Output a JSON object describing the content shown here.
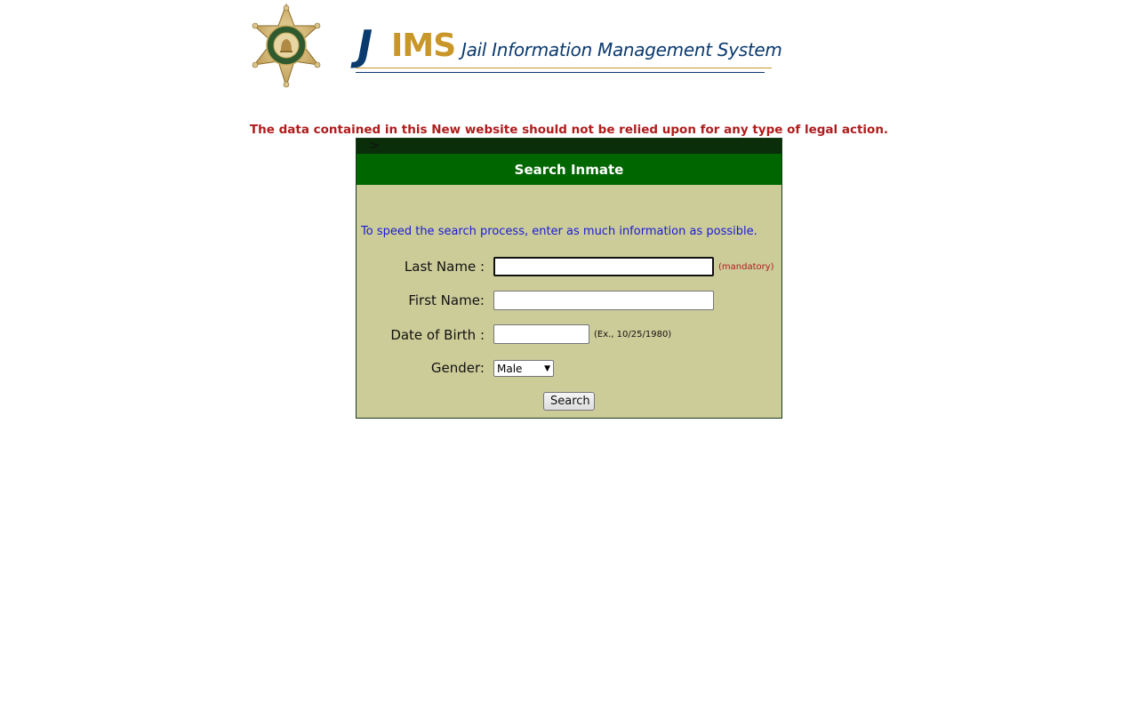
{
  "header": {
    "badge": {
      "top_text": "SHERIFF",
      "ring_text": "RIVERSIDE COUNTY"
    },
    "logo": {
      "mark_j": "J",
      "mark_ims": "IMS",
      "tagline": "Jail Information Management System"
    }
  },
  "disclaimer": "The data contained in this New website should not be relied upon for any type of legal action.",
  "panel": {
    "crumb": ">",
    "title": "Search Inmate",
    "instructions": "To speed the search process, enter as much information as possible.",
    "fields": {
      "last_name": {
        "label": "Last Name :",
        "value": "",
        "hint": "(mandatory)"
      },
      "first_name": {
        "label": "First Name:",
        "value": ""
      },
      "dob": {
        "label": "Date of Birth :",
        "value": "",
        "hint": "(Ex., 10/25/1980)"
      },
      "gender": {
        "label": "Gender:",
        "selected": "Male"
      }
    },
    "search_button": "Search"
  },
  "colors": {
    "panel_bg": "#cccc99",
    "header_green": "#006600",
    "top_bar": "#0a2e0a",
    "disclaimer_red": "#b01c1c",
    "instructions_blue": "#1a1ad6",
    "logo_navy": "#0b3a6e",
    "logo_gold": "#c9962a"
  }
}
